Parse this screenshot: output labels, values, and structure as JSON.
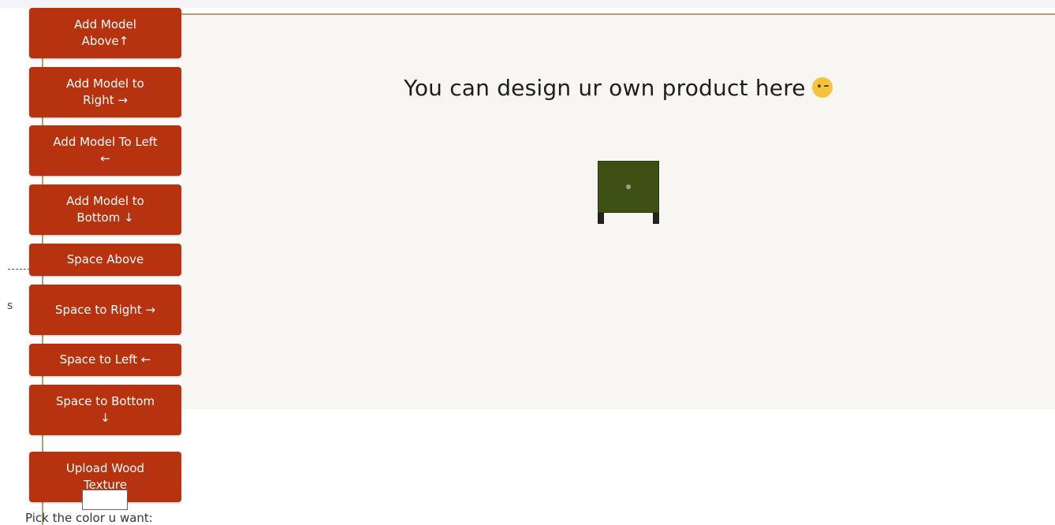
{
  "main": {
    "heading": "You can design ur own product here",
    "heading_emoji": "winking-face-icon"
  },
  "sidebar": {
    "stub_text": "s",
    "buttons": [
      {
        "label": "Add Model Above↑"
      },
      {
        "label": "Add Model to Right →"
      },
      {
        "label": "Add Model To Left ←"
      },
      {
        "label": "Add Model to Bottom ↓"
      },
      {
        "label": "Space Above"
      },
      {
        "label": "Space to Right →"
      },
      {
        "label": "Space to Left ←"
      },
      {
        "label": "Space to Bottom ↓"
      },
      {
        "label": "Upload Wood Texture"
      }
    ],
    "color_picker": {
      "label": "Pick the color u want:",
      "value": "#ffffff"
    }
  },
  "colors": {
    "button_bg": "#b7320e",
    "cabinet_body": "#3d5115",
    "canvas_bg": "#f8f6f2",
    "accent_line": "#b89f6a"
  }
}
